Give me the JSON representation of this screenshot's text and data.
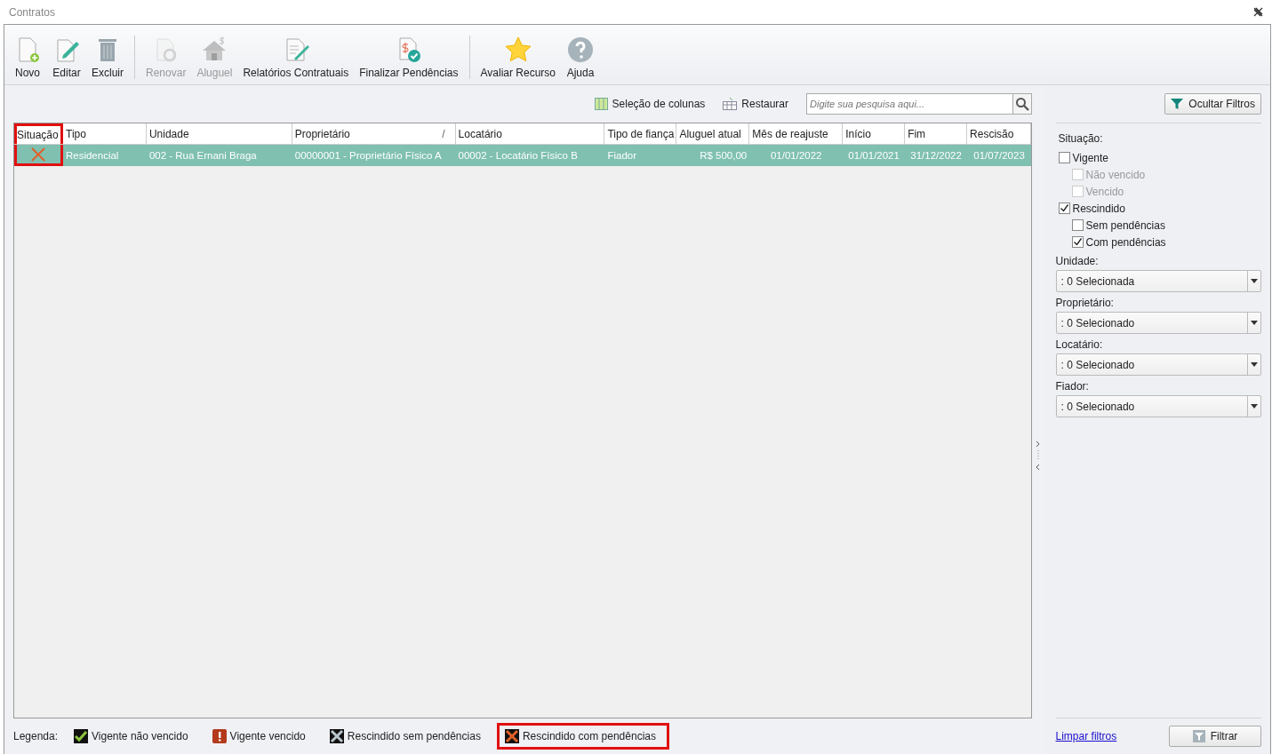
{
  "window": {
    "title": "Contratos"
  },
  "toolbar": [
    {
      "kind": "new",
      "label": "Novo",
      "disabled": false,
      "separator_before": false
    },
    {
      "kind": "edit",
      "label": "Editar",
      "disabled": false,
      "separator_before": false
    },
    {
      "kind": "delete",
      "label": "Excluir",
      "disabled": false,
      "separator_before": false
    },
    {
      "kind": "renew",
      "label": "Renovar",
      "disabled": true,
      "separator_before": true
    },
    {
      "kind": "rent",
      "label": "Aluguel",
      "disabled": true,
      "separator_before": false
    },
    {
      "kind": "report",
      "label": "Relatórios Contratuais",
      "disabled": false,
      "separator_before": false
    },
    {
      "kind": "finish",
      "label": "Finalizar Pendências",
      "disabled": false,
      "separator_before": false
    },
    {
      "kind": "star",
      "label": "Avaliar Recurso",
      "disabled": false,
      "separator_before": true
    },
    {
      "kind": "help",
      "label": "Ajuda",
      "disabled": false,
      "separator_before": false
    }
  ],
  "grid_toolbar": {
    "column_selection": "Seleção de colunas",
    "restore": "Restaurar",
    "search": {
      "placeholder": "Digite sua pesquisa aqui..."
    }
  },
  "table": {
    "columns": [
      {
        "label": "Situação",
        "highlighted": true
      },
      {
        "label": "Tipo",
        "highlighted": false
      },
      {
        "label": "Unidade",
        "highlighted": false
      },
      {
        "label": "Proprietário",
        "highlighted": false,
        "sort": "/"
      },
      {
        "label": "Locatário",
        "highlighted": false
      },
      {
        "label": "Tipo de fiança",
        "highlighted": false
      },
      {
        "label": "Aluguel atual",
        "highlighted": false
      },
      {
        "label": "Mês de reajuste",
        "highlighted": false
      },
      {
        "label": "Início",
        "highlighted": false
      },
      {
        "label": "Fim",
        "highlighted": false
      },
      {
        "label": "Rescisão",
        "highlighted": false
      }
    ],
    "rows": [
      {
        "selected": true,
        "kind": "rescinded_pending",
        "cells": [
          "",
          "Residencial",
          "002 - Rua Ernani Braga",
          "00000001 - Proprietário Físico A",
          "00002 - Locatário Físico B",
          "Fiador",
          "R$ 500,00",
          "01/01/2022",
          "01/01/2021",
          "31/12/2022",
          "01/07/2023"
        ]
      }
    ]
  },
  "legend": {
    "label": "Legenda:",
    "items": [
      {
        "kind": "valid",
        "label": "Vigente não vencido",
        "highlighted": false
      },
      {
        "kind": "expired",
        "label": "Vigente vencido",
        "highlighted": false
      },
      {
        "kind": "rescinded",
        "label": "Rescindido sem pendências",
        "highlighted": false
      },
      {
        "kind": "rescinded_pending",
        "label": "Rescindido com pendências",
        "highlighted": true
      }
    ]
  },
  "filters": {
    "hide_button": "Ocultar Filtros",
    "situation_label": "Situação:",
    "situation": [
      {
        "label": "Vigente",
        "checked": false,
        "disabled": false,
        "children": [
          {
            "label": "Não vencido",
            "checked": false,
            "disabled": true
          },
          {
            "label": "Vencido",
            "checked": false,
            "disabled": true
          }
        ]
      },
      {
        "label": "Rescindido",
        "checked": true,
        "disabled": false,
        "children": [
          {
            "label": "Sem pendências",
            "checked": false,
            "disabled": false
          },
          {
            "label": "Com pendências",
            "checked": true,
            "disabled": false
          }
        ]
      }
    ],
    "dropdowns": [
      {
        "label": "Unidade:",
        "value": ": 0 Selecionada"
      },
      {
        "label": "Proprietário:",
        "value": ": 0 Selecionado"
      },
      {
        "label": "Locatário:",
        "value": ": 0 Selecionado"
      },
      {
        "label": "Fiador:",
        "value": ": 0 Selecionado"
      }
    ],
    "clear_link": "Limpar filtros",
    "filter_button": "Filtrar"
  }
}
